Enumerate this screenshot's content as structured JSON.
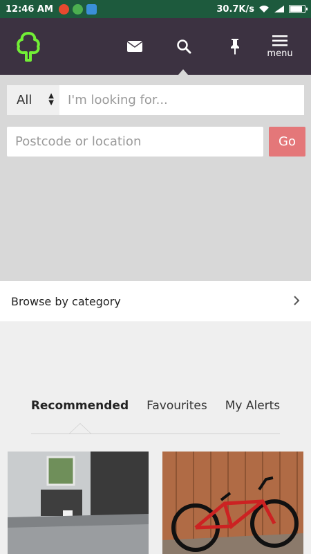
{
  "status_bar": {
    "time": "12:46 AM",
    "speed": "30.7K/s",
    "icons": [
      "w-app-icon",
      "circle-app-icon",
      "puzzle-app-icon",
      "wifi-icon",
      "signal-icon",
      "battery-icon"
    ]
  },
  "nav": {
    "logo": "tree-logo-icon",
    "menu_label": "menu"
  },
  "search": {
    "category_selected": "All",
    "query_placeholder": "I'm looking for...",
    "location_placeholder": "Postcode or location",
    "go_label": "Go"
  },
  "browse": {
    "title": "Browse by category"
  },
  "tabs": [
    {
      "label": "Recommended",
      "active": true
    },
    {
      "label": "Favourites",
      "active": false
    },
    {
      "label": "My Alerts",
      "active": false
    }
  ],
  "colors": {
    "status_bar": "#1d5a3d",
    "nav_bg": "#3c3241",
    "logo": "#72ef36",
    "go_button": "#e47779"
  }
}
